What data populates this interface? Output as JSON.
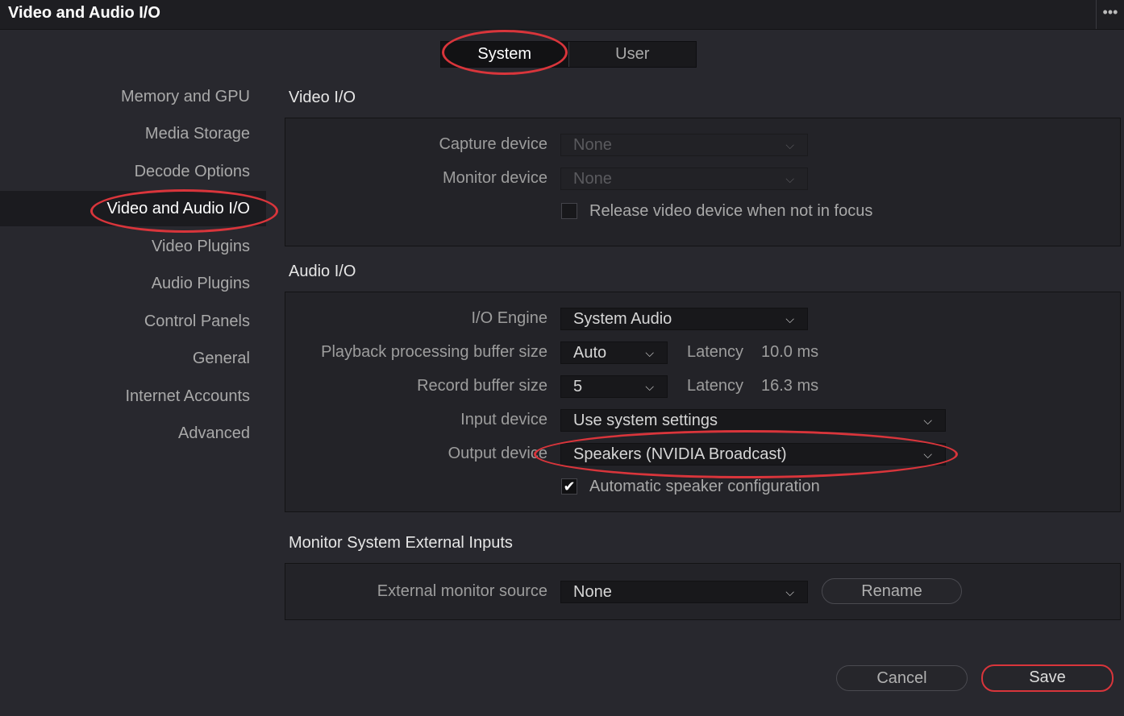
{
  "window": {
    "title": "Video and Audio I/O",
    "menu_icon": "•••"
  },
  "tabs": {
    "system": "System",
    "user": "User",
    "active": "System"
  },
  "sidebar": {
    "items": [
      {
        "label": "Memory and GPU"
      },
      {
        "label": "Media Storage"
      },
      {
        "label": "Decode Options"
      },
      {
        "label": "Video and Audio I/O",
        "active": true
      },
      {
        "label": "Video Plugins"
      },
      {
        "label": "Audio Plugins"
      },
      {
        "label": "Control Panels"
      },
      {
        "label": "General"
      },
      {
        "label": "Internet Accounts"
      },
      {
        "label": "Advanced"
      }
    ]
  },
  "video_io": {
    "title": "Video I/O",
    "capture_label": "Capture device",
    "capture_value": "None",
    "monitor_label": "Monitor device",
    "monitor_value": "None",
    "release_label": "Release video device when not in focus",
    "release_checked": false
  },
  "audio_io": {
    "title": "Audio I/O",
    "engine_label": "I/O Engine",
    "engine_value": "System Audio",
    "playback_label": "Playback processing buffer size",
    "playback_value": "Auto",
    "playback_latency_label": "Latency",
    "playback_latency_value": "10.0 ms",
    "record_label": "Record buffer size",
    "record_value": "5",
    "record_latency_label": "Latency",
    "record_latency_value": "16.3 ms",
    "input_label": "Input device",
    "input_value": "Use system settings",
    "output_label": "Output device",
    "output_value": "Speakers (NVIDIA Broadcast)",
    "auto_speaker_label": "Automatic speaker configuration",
    "auto_speaker_checked": true
  },
  "external": {
    "title": "Monitor System External Inputs",
    "source_label": "External monitor source",
    "source_value": "None",
    "rename_label": "Rename"
  },
  "footer": {
    "cancel_label": "Cancel",
    "save_label": "Save"
  },
  "icons": {
    "chevron": "⌵",
    "check": "✔"
  },
  "colors": {
    "highlight": "#d9353b",
    "background": "#28282e",
    "panel": "#232328"
  }
}
